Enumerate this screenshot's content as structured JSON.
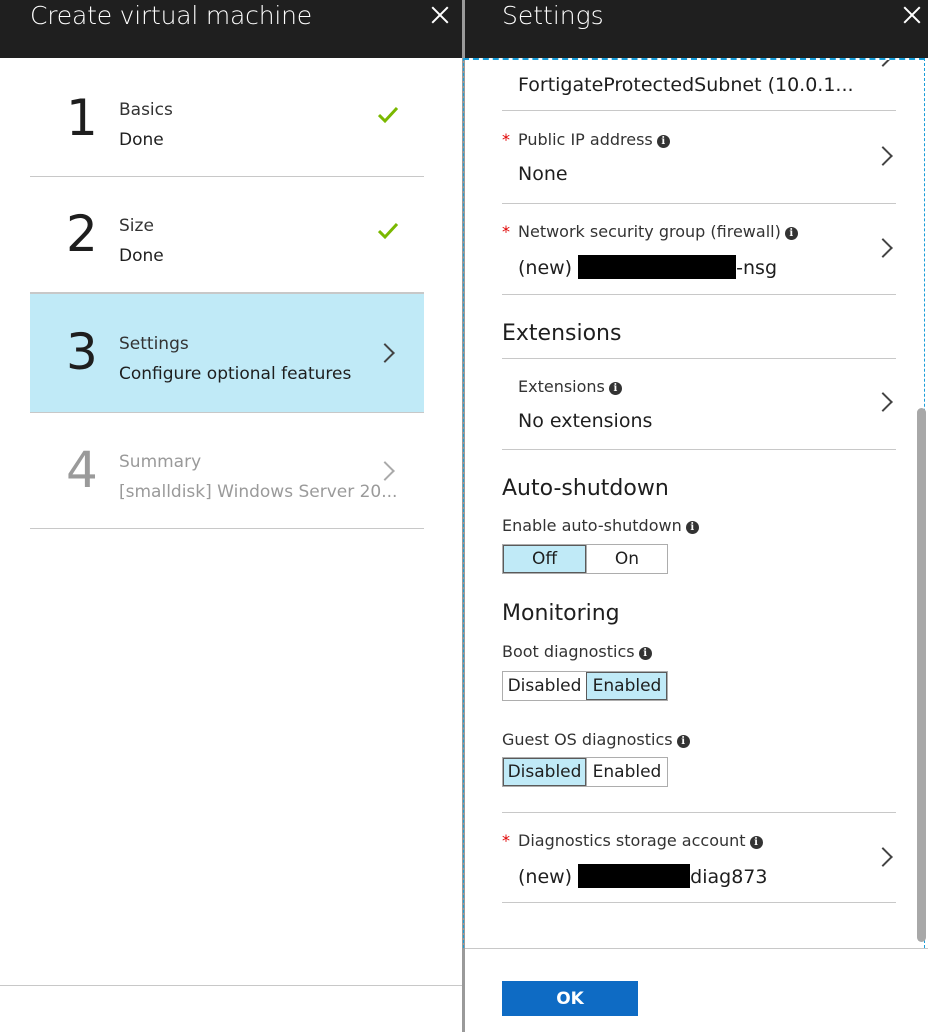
{
  "left_blade": {
    "title": "Create virtual machine",
    "steps": [
      {
        "number": "1",
        "name": "Basics",
        "status": "Done",
        "state": "done"
      },
      {
        "number": "2",
        "name": "Size",
        "status": "Done",
        "state": "done"
      },
      {
        "number": "3",
        "name": "Settings",
        "status": "Configure optional features",
        "state": "active"
      },
      {
        "number": "4",
        "name": "Summary",
        "status": "[smalldisk] Windows Server 20...",
        "state": "disabled"
      }
    ]
  },
  "right_blade": {
    "title": "Settings",
    "subnet_value": "FortigateProtectedSubnet (10.0.1...",
    "public_ip": {
      "label": "Public IP address",
      "value": "None"
    },
    "nsg": {
      "label": "Network security group (firewall)",
      "prefix": "(new)",
      "suffix": "-nsg"
    },
    "extensions_section": {
      "title": "Extensions",
      "label": "Extensions",
      "value": "No extensions"
    },
    "auto_shutdown": {
      "title": "Auto-shutdown",
      "label": "Enable auto-shutdown",
      "options": [
        "Off",
        "On"
      ],
      "selected": "Off"
    },
    "monitoring": {
      "title": "Monitoring",
      "boot_label": "Boot diagnostics",
      "boot_options": [
        "Disabled",
        "Enabled"
      ],
      "boot_selected": "Enabled",
      "guest_label": "Guest OS diagnostics",
      "guest_options": [
        "Disabled",
        "Enabled"
      ],
      "guest_selected": "Disabled"
    },
    "storage": {
      "label": "Diagnostics storage account",
      "prefix": "(new)",
      "suffix": "diag873"
    },
    "ok_label": "OK"
  },
  "colors": {
    "accent": "#0e6bc4",
    "selected_bg": "#c0eaf7",
    "check_green": "#7ab800",
    "required_red": "#e00000"
  }
}
